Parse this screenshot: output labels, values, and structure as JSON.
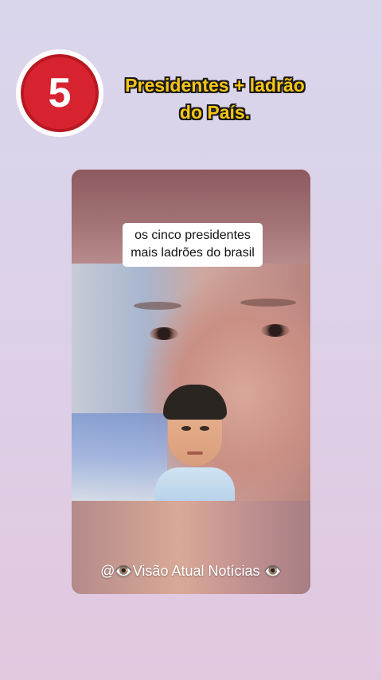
{
  "badge": {
    "number": "5"
  },
  "headline": {
    "line1": "Presidentes + ladrão",
    "line2": "do País."
  },
  "video": {
    "caption_line1": "os cinco presidentes",
    "caption_line2": "mais ladrões do brasil",
    "watermark": "@👁️Visão Atual Notícias 👁️"
  },
  "colors": {
    "badge_red": "#d7232f",
    "headline_yellow": "#f5c518"
  }
}
